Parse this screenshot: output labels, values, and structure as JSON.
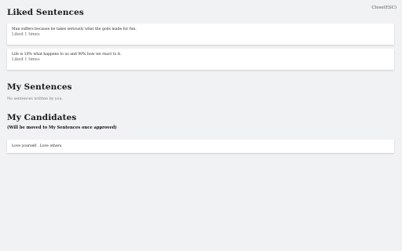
{
  "header": {
    "close_label": "Close(ESC)"
  },
  "liked": {
    "title": "Liked Sentences",
    "items": [
      {
        "text": "Man suffers because he takes seriously what the gods made for fun.",
        "liked": "Liked 1 times"
      },
      {
        "text": "Life is 10% what happens to us and 90% how we react to it.",
        "liked": "Liked 1 times"
      }
    ]
  },
  "mine": {
    "title": "My Sentences",
    "empty": "No sentences written by you."
  },
  "candidates": {
    "title": "My Candidates",
    "subtitle": "(Will be moved to My Sentences once approved)",
    "items": [
      {
        "text": "Love yourself . Love others."
      }
    ]
  }
}
